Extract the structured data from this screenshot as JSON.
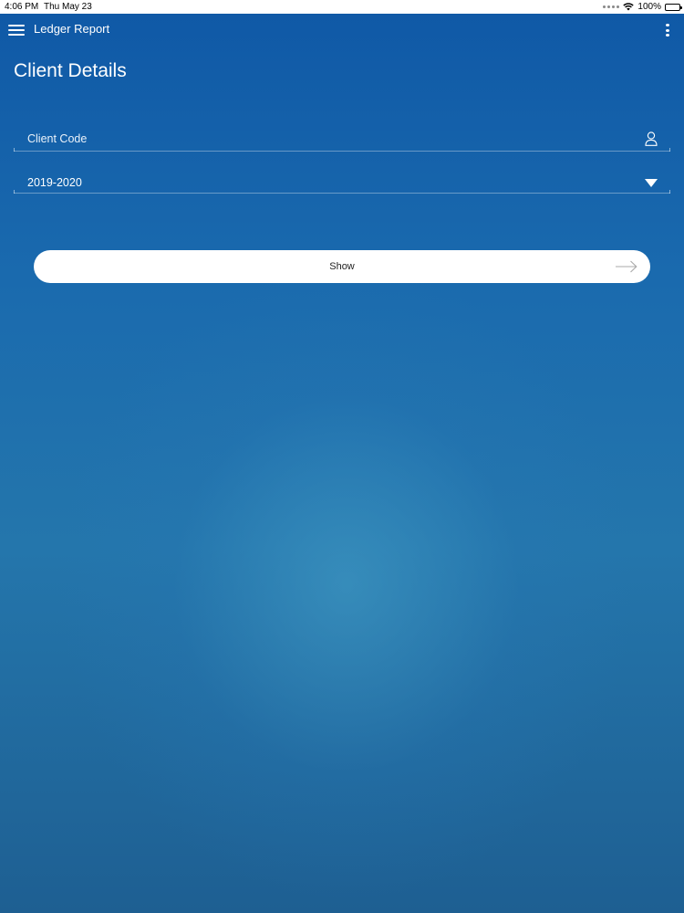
{
  "status_bar": {
    "time": "4:06 PM",
    "date": "Thu May 23",
    "battery_text": "100%",
    "battery_level": 1.0,
    "icons": [
      "signal-dots-icon",
      "wifi-icon",
      "battery-icon"
    ]
  },
  "app_bar": {
    "title": "Ledger Report",
    "left_icon": "hamburger-menu-icon",
    "right_icon": "more-vertical-icon"
  },
  "page": {
    "title": "Client Details"
  },
  "form": {
    "client_code": {
      "placeholder": "Client Code",
      "value": "",
      "icon": "user-icon"
    },
    "financial_year": {
      "selected": "2019-2020",
      "icon": "dropdown-arrow-icon"
    },
    "show_button": {
      "label": "Show",
      "icon": "arrow-right-icon"
    }
  },
  "colors": {
    "background_top": "#0f58a6",
    "background_center": "#2f8cb8",
    "button_bg": "#ffffff",
    "button_text": "#222222",
    "text": "#ffffff"
  }
}
